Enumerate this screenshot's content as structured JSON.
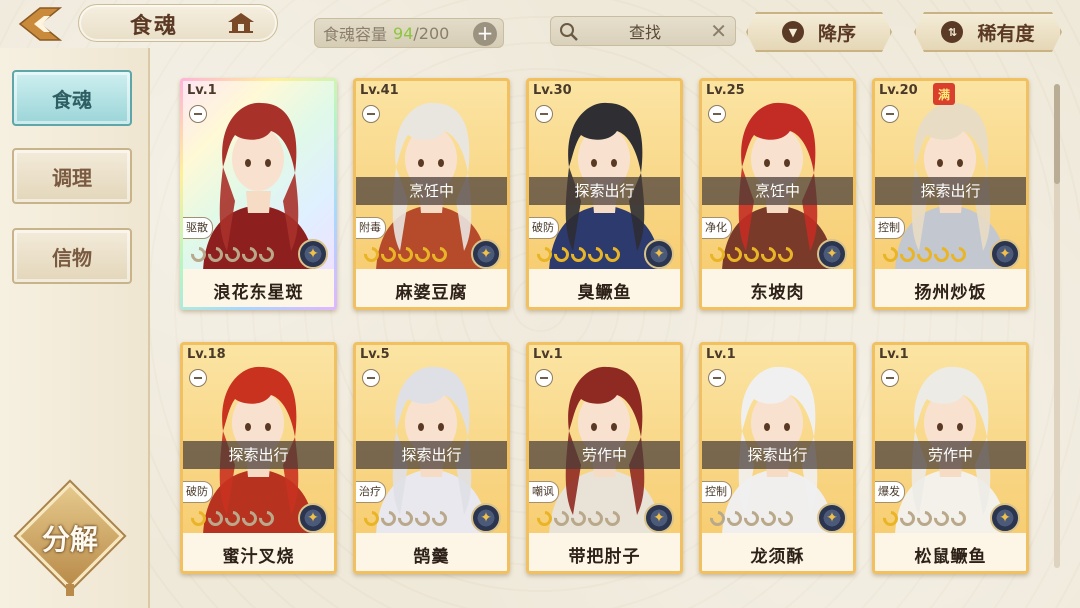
{
  "header": {
    "title": "食魂",
    "capacity_label": "食魂容量",
    "capacity_current": "94",
    "capacity_max": "/200",
    "search_placeholder": "查找",
    "sort_label": "降序",
    "filter_label": "稀有度"
  },
  "sidebar": {
    "items": [
      {
        "label": "食魂",
        "active": true
      },
      {
        "label": "调理",
        "active": false
      },
      {
        "label": "信物",
        "active": false
      }
    ],
    "decompose_label": "分解"
  },
  "cards": [
    {
      "level": "Lv.1",
      "name": "浪花东星斑",
      "status": "",
      "tag": "驱散",
      "stars": 0,
      "rainbow": true,
      "hair": "#a8312a",
      "cloth": "#8e1f1f",
      "badge": ""
    },
    {
      "level": "Lv.41",
      "name": "麻婆豆腐",
      "status": "烹饪中",
      "tag": "附毒",
      "stars": 5,
      "rainbow": false,
      "hair": "#e9e6e0",
      "cloth": "#b54b2a",
      "badge": ""
    },
    {
      "level": "Lv.30",
      "name": "臭鳜鱼",
      "status": "探索出行",
      "tag": "破防",
      "stars": 5,
      "rainbow": false,
      "hair": "#2e2e33",
      "cloth": "#2d3a6d",
      "badge": ""
    },
    {
      "level": "Lv.25",
      "name": "东坡肉",
      "status": "烹饪中",
      "tag": "净化",
      "stars": 5,
      "rainbow": false,
      "hair": "#c32c24",
      "cloth": "#7a3a2a",
      "badge": ""
    },
    {
      "level": "Lv.20",
      "name": "扬州炒饭",
      "status": "探索出行",
      "tag": "控制",
      "stars": 5,
      "rainbow": false,
      "hair": "#e8dcc4",
      "cloth": "#c3c7cf",
      "badge": "满"
    },
    {
      "level": "Lv.18",
      "name": "蜜汁叉烧",
      "status": "探索出行",
      "tag": "破防",
      "stars": 1,
      "rainbow": false,
      "hair": "#c8321f",
      "cloth": "#b7321f",
      "badge": ""
    },
    {
      "level": "Lv.5",
      "name": "鹄羹",
      "status": "探索出行",
      "tag": "治疗",
      "stars": 1,
      "rainbow": false,
      "hair": "#dfe0e6",
      "cloth": "#e9e8ef",
      "badge": ""
    },
    {
      "level": "Lv.1",
      "name": "带把肘子",
      "status": "劳作中",
      "tag": "嘲讽",
      "stars": 1,
      "rainbow": false,
      "hair": "#8f2a22",
      "cloth": "#e8e2d7",
      "badge": ""
    },
    {
      "level": "Lv.1",
      "name": "龙须酥",
      "status": "探索出行",
      "tag": "控制",
      "stars": 0,
      "rainbow": false,
      "hair": "#f1f0f0",
      "cloth": "#f0efee",
      "badge": ""
    },
    {
      "level": "Lv.1",
      "name": "松鼠鳜鱼",
      "status": "劳作中",
      "tag": "爆发",
      "stars": 1,
      "rainbow": false,
      "hair": "#ecebe6",
      "cloth": "#f3f1ea",
      "badge": ""
    }
  ],
  "colors": {
    "accent_active": "#9bd5d8",
    "card_gold": "#f6c969",
    "capacity_green": "#8cc63f"
  }
}
